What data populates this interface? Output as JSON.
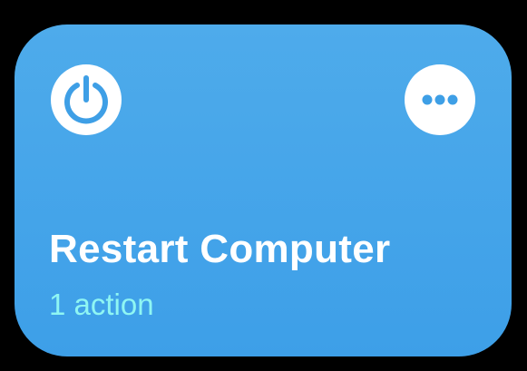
{
  "shortcut": {
    "title": "Restart Computer",
    "subtitle": "1 action",
    "icon": "power-icon",
    "more_icon": "ellipsis-icon",
    "colors": {
      "card_top": "#4eabeb",
      "card_bottom": "#3d9fe8",
      "subtitle": "#8ff6f3",
      "icon_background": "#ffffff",
      "icon_glyph": "#3e9fe6"
    }
  }
}
